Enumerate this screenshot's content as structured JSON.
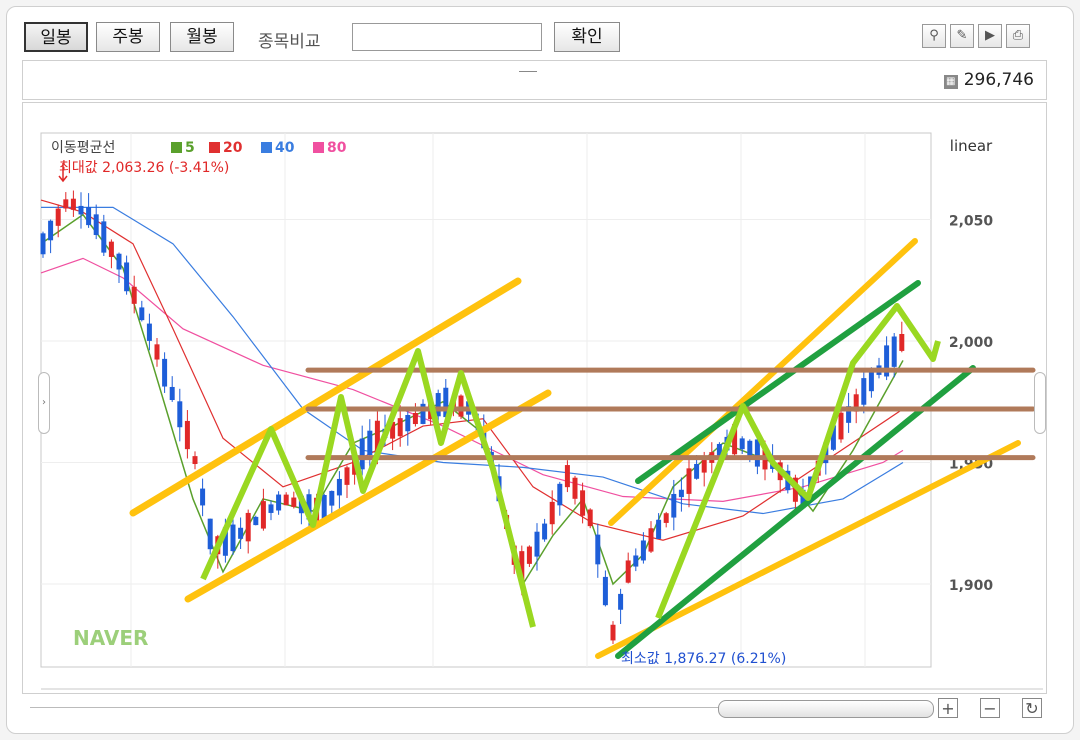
{
  "toolbar": {
    "daily": "일봉",
    "weekly": "주봉",
    "monthly": "월봉",
    "compare_label": "종목비교",
    "compare_value": "",
    "confirm": "확인"
  },
  "info": {
    "volume": "296,746",
    "volume_icon": "chart-icon"
  },
  "chart_data": {
    "type": "candlestick",
    "scale": "linear",
    "y_ticks": [
      "2,050",
      "2,000",
      "1,950",
      "1,900"
    ],
    "ylim": [
      1870,
      2070
    ],
    "ma_legend_title": "이동평균선",
    "ma_legend": [
      {
        "label": "5",
        "color": "#5aa02c"
      },
      {
        "label": "20",
        "color": "#e03030"
      },
      {
        "label": "40",
        "color": "#3a7de0"
      },
      {
        "label": "80",
        "color": "#f050a0"
      }
    ],
    "max_annotation": "최대값 2,063.26 (-3.41%)",
    "min_annotation": "최소값 1,876.27 (6.21%)",
    "max_value": 2063.26,
    "min_value": 1876.27,
    "horizontal_levels": [
      1988,
      1972,
      1952
    ],
    "watermark": "NAVER",
    "colors": {
      "up": "#e02828",
      "down": "#1e5ed8",
      "resistance": "#b07a5a",
      "channel": "#ffc20e",
      "trend": "#20a040",
      "zigzag": "#9ad821"
    }
  }
}
